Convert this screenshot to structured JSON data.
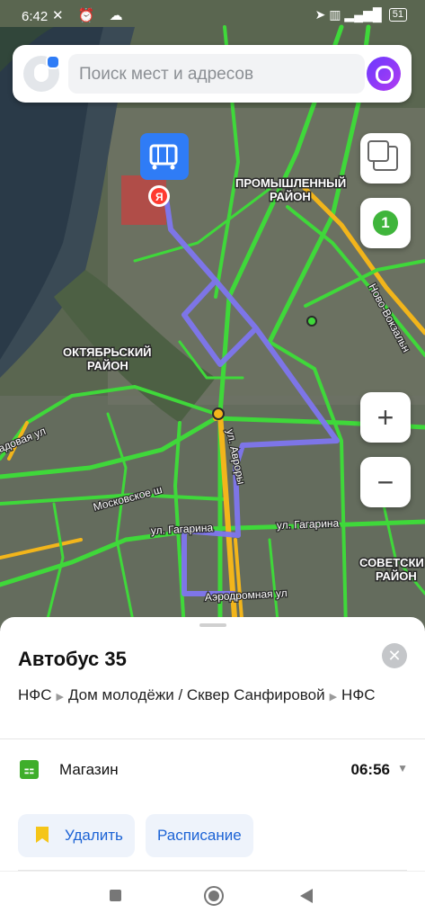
{
  "status_bar": {
    "time": "6:42",
    "left_icons": "✕ ⏰ ☁",
    "right_icons": "➤ ▥ ▂▄▆█",
    "battery": "51"
  },
  "search": {
    "placeholder": "Поиск мест и адресов"
  },
  "map_labels": {
    "district_promyshlenny_1": "ПРОМЫШЛЕННЫЙ",
    "district_promyshlenny_2": "РАЙОН",
    "district_oktyabrsky_1": "ОКТЯБРЬСКИЙ",
    "district_oktyabrsky_2": "РАЙОН",
    "district_sovetsky_1": "СОВЕТСКИ",
    "district_sovetsky_2": "РАЙОН",
    "street_novo_vokzalnaya": "Ново-Вокзальн",
    "street_avrory": "ул. Авроры",
    "street_moskovskoe": "Московское ш",
    "street_gagarina_1": "ул. Гагарина",
    "street_gagarina_2": "ул. Гагарина",
    "street_aerodromnaya": "Аэродромная ул",
    "street_sadovaya": "адовая ул",
    "marker_logo": "Я"
  },
  "map_controls": {
    "traffic_level": "1",
    "zoom_in": "+",
    "zoom_out": "−"
  },
  "sheet": {
    "title": "Автобус 35",
    "close": "✕",
    "route": {
      "stop1": "НФС",
      "stop2": "Дом молодёжи / Сквер Санфировой",
      "stop3": "НФС"
    },
    "stop_row": {
      "name": "Магазин",
      "time": "06:56",
      "chevron": "▼"
    },
    "buttons": {
      "delete": "Удалить",
      "schedule": "Расписание"
    }
  },
  "colors": {
    "accent": "#1c63d5",
    "traffic_green": "#3fd83a",
    "traffic_yellow": "#f2b51b",
    "route": "#7f76ef"
  }
}
